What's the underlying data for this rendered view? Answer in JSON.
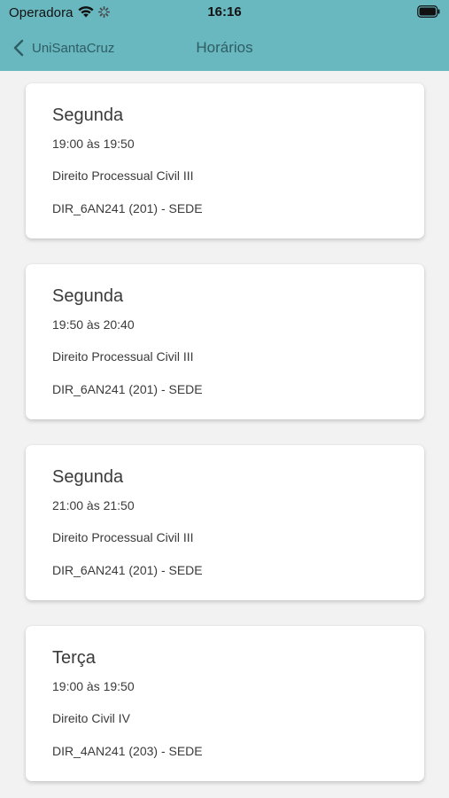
{
  "status_bar": {
    "carrier": "Operadora",
    "time": "16:16",
    "icons": [
      "wifi-icon",
      "activity-icon",
      "battery-icon"
    ]
  },
  "nav": {
    "back_label": "UniSantaCruz",
    "title": "Horários"
  },
  "colors": {
    "header_bg": "#69b7bf",
    "nav_text": "#2e5e64",
    "page_bg": "#f2f2f2",
    "card_bg": "#ffffff"
  },
  "schedule": [
    {
      "day": "Segunda",
      "time": "19:00 às 19:50",
      "subject": "Direito Processual Civil III",
      "class": "DIR_6AN241 (201) - SEDE"
    },
    {
      "day": "Segunda",
      "time": "19:50 às 20:40",
      "subject": "Direito Processual Civil III",
      "class": "DIR_6AN241 (201) - SEDE"
    },
    {
      "day": "Segunda",
      "time": "21:00 às 21:50",
      "subject": "Direito Processual Civil III",
      "class": "DIR_6AN241 (201) - SEDE"
    },
    {
      "day": "Terça",
      "time": "19:00 às 19:50",
      "subject": "Direito Civil IV",
      "class": "DIR_4AN241 (203) - SEDE"
    }
  ]
}
